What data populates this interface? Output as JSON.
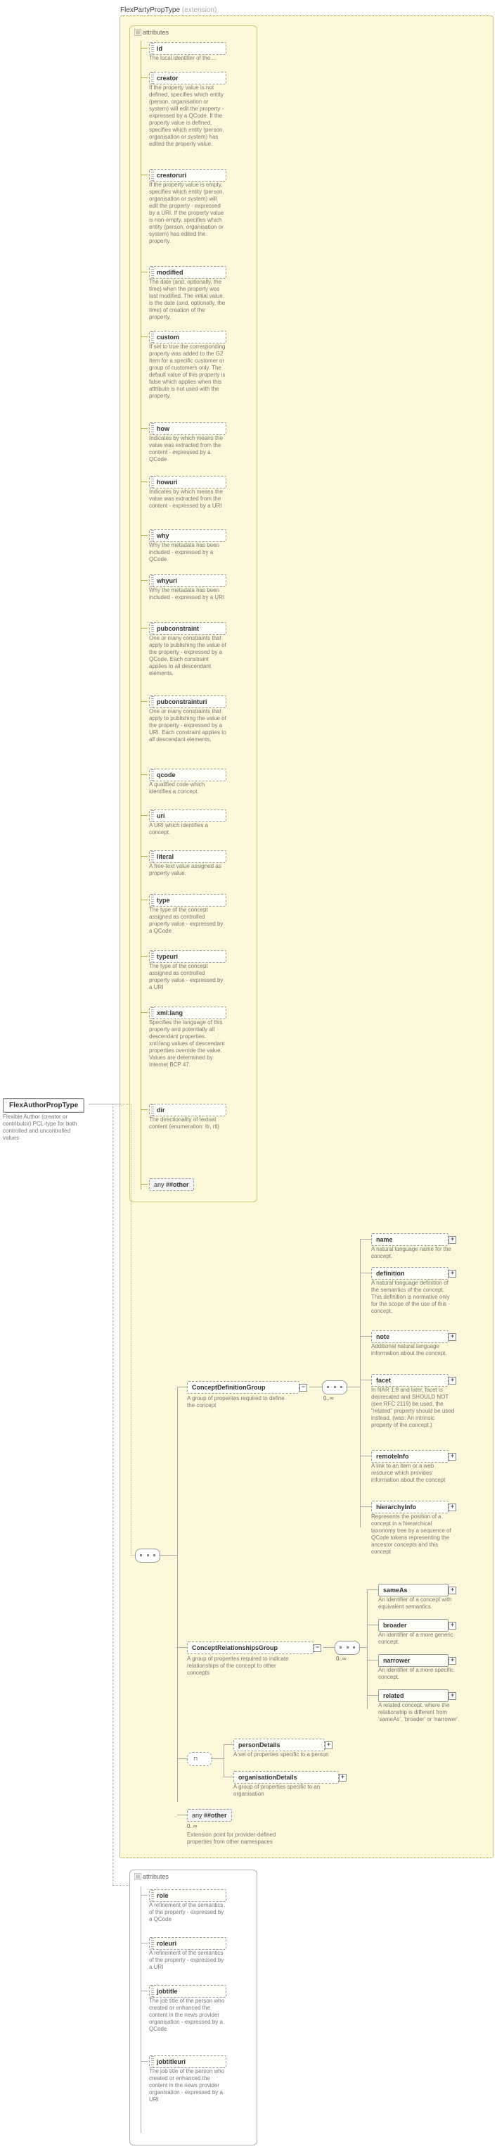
{
  "root": {
    "name": "FlexAuthorPropType",
    "desc": "Flexible Author (creator or contributor) PCL-type for both controlled and uncontrolled values"
  },
  "extension_base": "FlexPartyPropType",
  "extension_suffix": "(extension)",
  "attr_header": "attributes",
  "inherited_attrs": [
    {
      "name": "id",
      "desc": "The local identifier of the ..."
    },
    {
      "name": "creator",
      "desc": "If the property value is not defined, specifies which entity (person, organisation or system) will edit the property - expressed by a QCode. If the property value is defined, specifies which entity (person, organisation or system) has edited the property value."
    },
    {
      "name": "creatoruri",
      "desc": "If the property value is empty, specifies which entity (person, organisation or system) will edit the property - expressed by a URI. If the property value is non-empty, specifies which entity (person, organisation or system) has edited the property."
    },
    {
      "name": "modified",
      "desc": "The date (and, optionally, the time) when the property was last modified. The initial value is the date (and, optionally, the time) of creation of the property."
    },
    {
      "name": "custom",
      "desc": "If set to true the corresponding property was added to the G2 Item for a specific customer or group of customers only. The default value of this property is false which applies when this attribute is not used with the property."
    },
    {
      "name": "how",
      "desc": "Indicates by which means the value was extracted from the content - expressed by a QCode"
    },
    {
      "name": "howuri",
      "desc": "Indicates by which means the value was extracted from the content - expressed by a URI"
    },
    {
      "name": "why",
      "desc": "Why the metadata has been included - expressed by a QCode"
    },
    {
      "name": "whyuri",
      "desc": "Why the metadata has been included - expressed by a URI"
    },
    {
      "name": "pubconstraint",
      "desc": "One or many constraints that apply to publishing the value of the property - expressed by a QCode. Each constraint applies to all descendant elements."
    },
    {
      "name": "pubconstrainturi",
      "desc": "One or many constraints that apply to publishing the value of the property - expressed by a URI. Each constraint applies to all descendant elements."
    },
    {
      "name": "qcode",
      "desc": "A qualified code which identifies a concept."
    },
    {
      "name": "uri",
      "desc": "A URI which identifies a concept."
    },
    {
      "name": "literal",
      "desc": "A free-text value assigned as property value."
    },
    {
      "name": "type",
      "desc": "The type of the concept assigned as controlled property value - expressed by a QCode"
    },
    {
      "name": "typeuri",
      "desc": "The type of the concept assigned as controlled property value - expressed by a URI"
    },
    {
      "name": "xml:lang",
      "desc": "Specifies the language of this property and potentially all descendant properties. xml:lang values of descendant properties override the value. Values are determined by Internet BCP 47."
    },
    {
      "name": "dir",
      "desc": "The directionality of textual content (enumeration: ltr, rtl)"
    }
  ],
  "inherited_wildcard_attr": "##other",
  "model_groups": {
    "defgroup": {
      "name": "ConceptDefinitionGroup",
      "desc": "A group of properites required to define the concept",
      "children": [
        {
          "name": "name",
          "desc": "A natural language name for the concept."
        },
        {
          "name": "definition",
          "desc": "A natural language definition of the semantics of the concept. This definition is normative only for the scope of the use of this concept."
        },
        {
          "name": "note",
          "desc": "Additional natural language information about the concept."
        },
        {
          "name": "facet",
          "desc": "In NAR 1.8 and later, facet is deprecated and SHOULD NOT (see RFC 2119) be used, the \"related\" property should be used instead. (was: An intrinsic property of the concept.)"
        },
        {
          "name": "remoteInfo",
          "desc": "A link to an item or a web resource which provides information about the concept"
        },
        {
          "name": "hierarchyInfo",
          "desc": "Represents the position of a concept in a hierarchical taxonomy tree by a sequence of QCode tokens representing the ancestor concepts and this concept"
        }
      ]
    },
    "relgroup": {
      "name": "ConceptRelationshipsGroup",
      "desc": "A group of properites required to indicate relationships of the concept to other concepts",
      "children": [
        {
          "name": "sameAs",
          "desc": "An identifier of a concept with equivalent semantics"
        },
        {
          "name": "broader",
          "desc": "An identifier of a more generic concept."
        },
        {
          "name": "narrower",
          "desc": "An identifier of a more specific concept."
        },
        {
          "name": "related",
          "desc": "A related concept, where the relationship is different from 'sameAs', 'broader' or 'narrower'."
        }
      ]
    },
    "choice": [
      {
        "name": "personDetails",
        "desc": "A set of properties specific to a person"
      },
      {
        "name": "organisationDetails",
        "desc": "A group of properties specific to an organisation"
      }
    ],
    "any_other": {
      "label": "##other",
      "card": "0..∞",
      "desc": "Extension point for provider-defined properties from other namespaces"
    }
  },
  "own_attrs": [
    {
      "name": "role",
      "desc": "A refinement of the semantics of the property - expressed by a QCode"
    },
    {
      "name": "roleuri",
      "desc": "A refinement of the semantics of the property - expressed by a URI"
    },
    {
      "name": "jobtitle",
      "desc": "The job title of the person who created or enhanced the content in the news provider organisation - expressed by a QCode"
    },
    {
      "name": "jobtitleuri",
      "desc": "The job title of the person who created or enhanced the content in the news provider organisation - expressed by a URI"
    }
  ],
  "cardinality_label": "0..∞",
  "any_label": "any"
}
